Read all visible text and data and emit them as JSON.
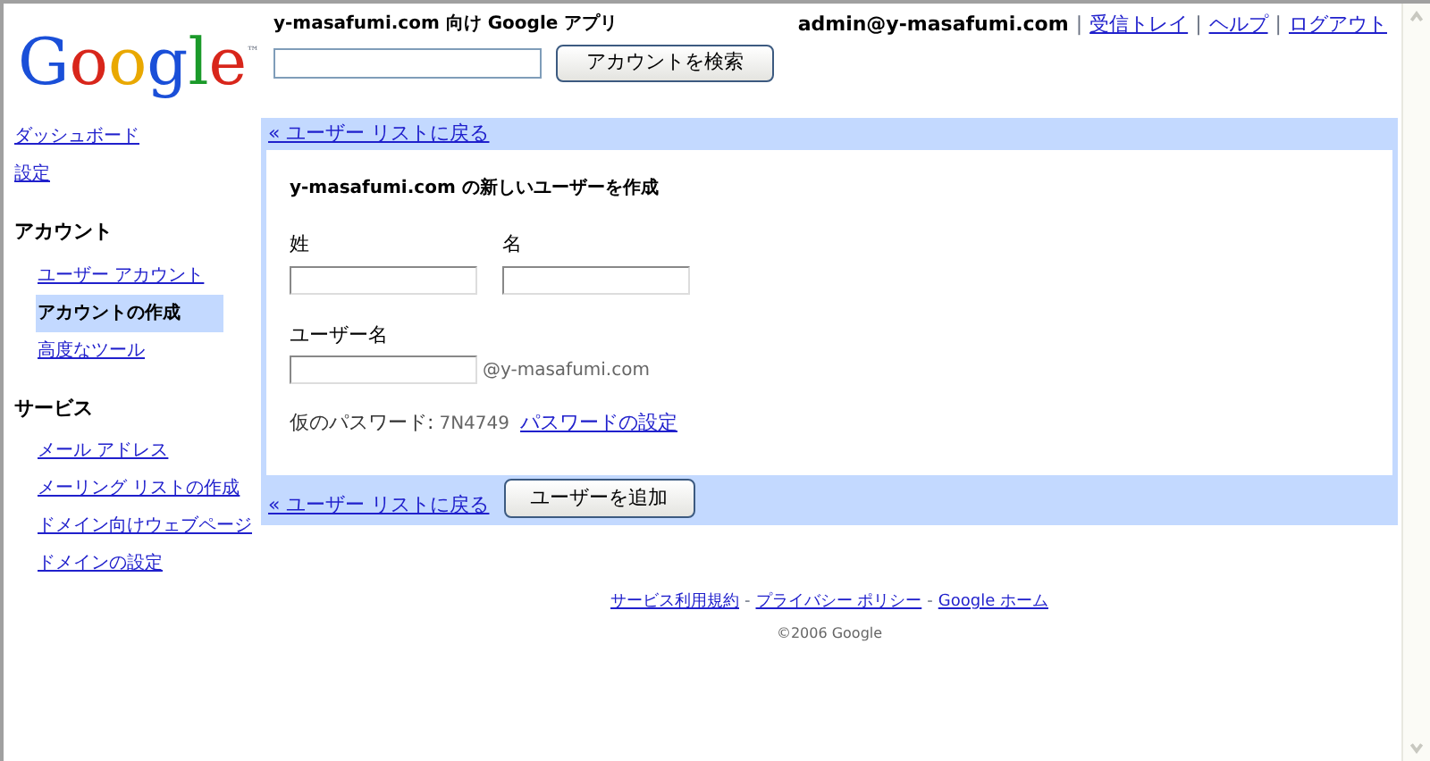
{
  "header": {
    "logo": "Google",
    "logo_mark": "™",
    "title": "y-masafumi.com 向け Google アプリ",
    "search_button": "アカウントを検索",
    "user": "admin@y-masafumi.com",
    "links": [
      "受信トレイ",
      "ヘルプ",
      "ログアウト"
    ],
    "separator": "|"
  },
  "sidebar": [
    {
      "kind": "link",
      "label": "ダッシュボード",
      "selected": false
    },
    {
      "kind": "link",
      "label": "設定",
      "selected": false
    },
    {
      "kind": "heading",
      "label": "アカウント"
    },
    {
      "kind": "sublink",
      "label": "ユーザー アカウント",
      "selected": false
    },
    {
      "kind": "sublink",
      "label": "アカウントの作成",
      "selected": true
    },
    {
      "kind": "sublink",
      "label": "高度なツール",
      "selected": false
    },
    {
      "kind": "heading",
      "label": "サービス"
    },
    {
      "kind": "sublink",
      "label": "メール アドレス",
      "selected": false
    },
    {
      "kind": "sublink",
      "label": "メーリング リストの作成",
      "selected": false
    },
    {
      "kind": "sublink",
      "label": "ドメイン向けウェブページ",
      "selected": false
    },
    {
      "kind": "sublink",
      "label": "ドメインの設定",
      "selected": false
    }
  ],
  "form": {
    "back_link_top": "« ユーザー リストに戻る",
    "title": "y-masafumi.com の新しいユーザーを作成",
    "last_name_label": "姓",
    "first_name_label": "名",
    "username_label": "ユーザー名",
    "domain_suffix": "@y-masafumi.com",
    "password_label": "仮のパスワード:",
    "password": "7N4749",
    "password_link": "パスワードの設定",
    "back_link_bottom": "« ユーザー リストに戻る",
    "submit": "ユーザーを追加"
  },
  "footer": {
    "separator": "-",
    "links": [
      "サービス利用規約",
      "プライバシー ポリシー",
      "Google ホーム"
    ],
    "copyright": "©2006 Google"
  }
}
